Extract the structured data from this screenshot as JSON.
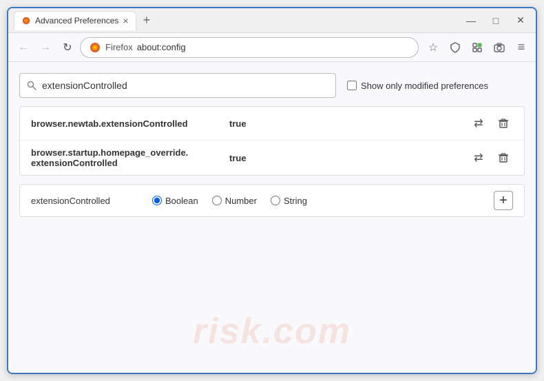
{
  "window": {
    "title": "Advanced Preferences",
    "tab_close": "×",
    "new_tab": "+",
    "minimize": "—",
    "maximize": "□",
    "close": "✕"
  },
  "navbar": {
    "back": "←",
    "forward": "→",
    "refresh": "↻",
    "browser_name": "Firefox",
    "url": "about:config",
    "bookmark": "☆",
    "shield": "🛡",
    "extensions": "🧩",
    "menu": "≡"
  },
  "search": {
    "placeholder": "extensionControlled",
    "value": "extensionControlled",
    "show_modified_label": "Show only modified preferences"
  },
  "results": [
    {
      "name": "browser.newtab.extensionControlled",
      "value": "true"
    },
    {
      "name": "browser.startup.homepage_override.\nextensionControlled",
      "value": "true",
      "multiline": true,
      "name_line1": "browser.startup.homepage_override.",
      "name_line2": "extensionControlled"
    }
  ],
  "add_row": {
    "name": "extensionControlled",
    "types": [
      "Boolean",
      "Number",
      "String"
    ],
    "selected_type": "Boolean",
    "add_btn": "+"
  },
  "watermark": "risk.com"
}
